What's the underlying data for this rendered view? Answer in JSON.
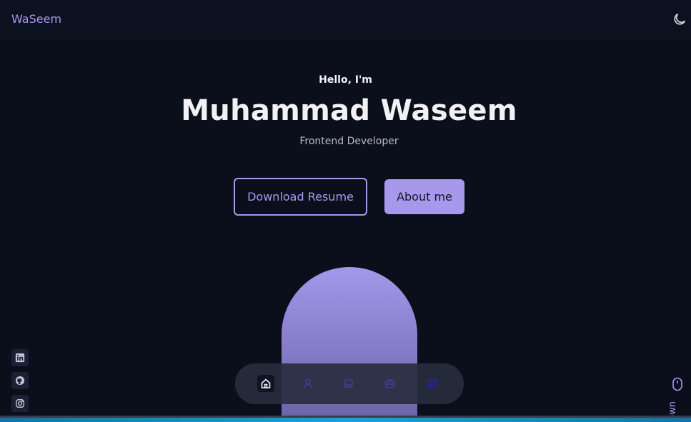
{
  "header": {
    "logo": "WaSeem",
    "theme_icon": "moon-icon"
  },
  "hero": {
    "greeting": "Hello, I'm",
    "name": "Muhammad Waseem",
    "role": "Frontend Developer",
    "download_label": "Download Resume",
    "about_label": "About me"
  },
  "social": [
    {
      "icon": "linkedin-icon"
    },
    {
      "icon": "github-icon"
    },
    {
      "icon": "instagram-icon"
    }
  ],
  "dock": [
    {
      "icon": "home-icon",
      "active": true
    },
    {
      "icon": "user-icon"
    },
    {
      "icon": "laptop-icon"
    },
    {
      "icon": "briefcase-icon"
    },
    {
      "icon": "message-icon"
    }
  ],
  "scroll": {
    "label": "own",
    "icon": "mouse-icon"
  },
  "colors": {
    "accent": "#a699ec",
    "background": "#0b0f1c"
  }
}
